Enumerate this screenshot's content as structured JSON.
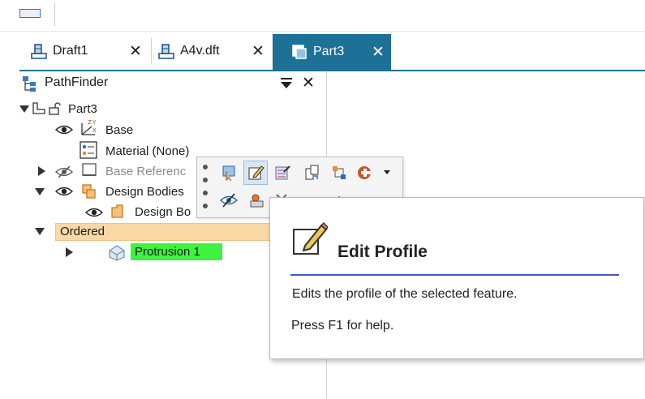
{
  "tabs": [
    {
      "label": "Draft1",
      "active": false
    },
    {
      "label": "A4v.dft",
      "active": false
    },
    {
      "label": "Part3",
      "active": true
    }
  ],
  "tab_close_glyph": "✕",
  "pathfinder": {
    "title": "PathFinder",
    "close_glyph": "✕",
    "tree": {
      "part": "Part3",
      "base": "Base",
      "material": "Material (None)",
      "base_reference": "Base Referenc",
      "design_bodies": "Design Bodies",
      "design_body": "Design Bo",
      "ordered": "Ordered",
      "protrusion": "Protrusion 1"
    }
  },
  "mini_toolbar": {
    "icons": [
      "select-icon",
      "edit-profile-icon",
      "edit-definition-icon",
      "copy-icon",
      "dimensions-icon",
      "appearance-icon",
      "hide-icon",
      "body-color-icon",
      "trim-icon",
      "sketch-icon",
      "relations-icon",
      "measure-icon"
    ]
  },
  "tooltip": {
    "title": "Edit Profile",
    "description": "Edits the profile of the selected feature.",
    "help": "Press F1 for help."
  },
  "colors": {
    "active_tab": "#1d7096",
    "ordered_highlight": "#f9d8a6",
    "selection_green": "#3ff23f",
    "tooltip_rule": "#3c58c4"
  }
}
